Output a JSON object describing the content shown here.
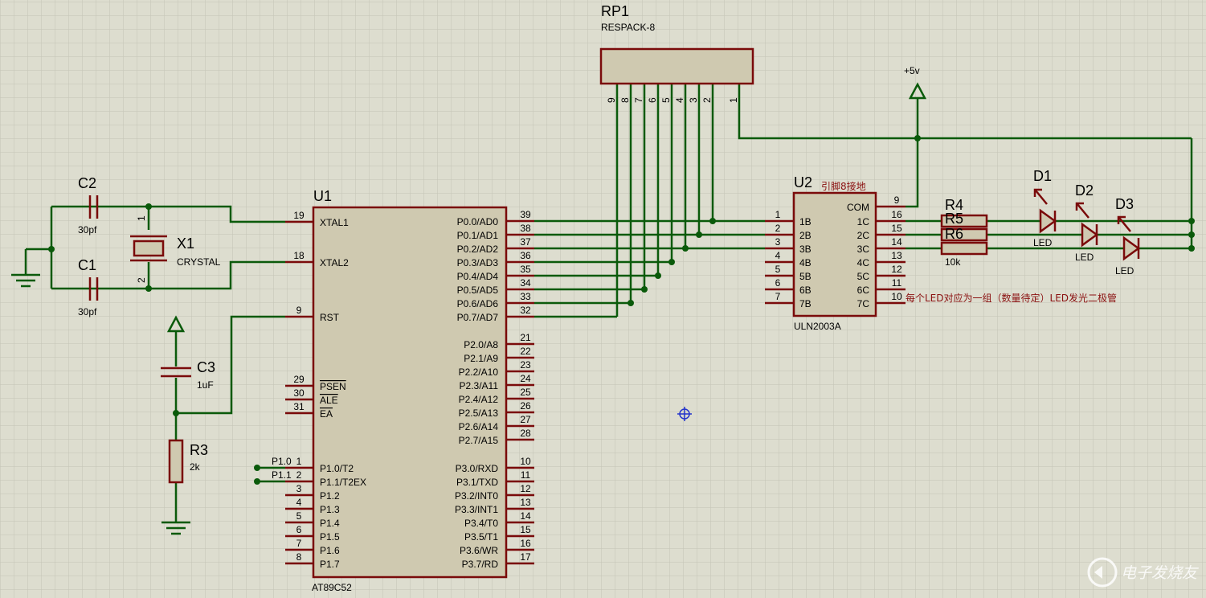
{
  "u1": {
    "ref": "U1",
    "part": "AT89C52",
    "left_pins": [
      {
        "num": "19",
        "name": "XTAL1"
      },
      {
        "num": "18",
        "name": "XTAL2"
      },
      {
        "num": "9",
        "name": "RST"
      },
      {
        "num": "29",
        "name": "PSEN"
      },
      {
        "num": "30",
        "name": "ALE"
      },
      {
        "num": "31",
        "name": "EA"
      },
      {
        "num": "1",
        "name": "P1.0/T2"
      },
      {
        "num": "2",
        "name": "P1.1/T2EX"
      },
      {
        "num": "3",
        "name": "P1.2"
      },
      {
        "num": "4",
        "name": "P1.3"
      },
      {
        "num": "5",
        "name": "P1.4"
      },
      {
        "num": "6",
        "name": "P1.5"
      },
      {
        "num": "7",
        "name": "P1.6"
      },
      {
        "num": "8",
        "name": "P1.7"
      }
    ],
    "right_pins": [
      {
        "num": "39",
        "name": "P0.0/AD0"
      },
      {
        "num": "38",
        "name": "P0.1/AD1"
      },
      {
        "num": "37",
        "name": "P0.2/AD2"
      },
      {
        "num": "36",
        "name": "P0.3/AD3"
      },
      {
        "num": "35",
        "name": "P0.4/AD4"
      },
      {
        "num": "34",
        "name": "P0.5/AD5"
      },
      {
        "num": "33",
        "name": "P0.6/AD6"
      },
      {
        "num": "32",
        "name": "P0.7/AD7"
      },
      {
        "num": "21",
        "name": "P2.0/A8"
      },
      {
        "num": "22",
        "name": "P2.1/A9"
      },
      {
        "num": "23",
        "name": "P2.2/A10"
      },
      {
        "num": "24",
        "name": "P2.3/A11"
      },
      {
        "num": "25",
        "name": "P2.4/A12"
      },
      {
        "num": "26",
        "name": "P2.5/A13"
      },
      {
        "num": "27",
        "name": "P2.6/A14"
      },
      {
        "num": "28",
        "name": "P2.7/A15"
      },
      {
        "num": "10",
        "name": "P3.0/RXD"
      },
      {
        "num": "11",
        "name": "P3.1/TXD"
      },
      {
        "num": "12",
        "name": "P3.2/INT0"
      },
      {
        "num": "13",
        "name": "P3.3/INT1"
      },
      {
        "num": "14",
        "name": "P3.4/T0"
      },
      {
        "num": "15",
        "name": "P3.5/T1"
      },
      {
        "num": "16",
        "name": "P3.6/WR"
      },
      {
        "num": "17",
        "name": "P3.7/RD"
      }
    ],
    "net_p10": "P1.0",
    "net_p11": "P1.1"
  },
  "u2": {
    "ref": "U2",
    "part": "ULN2003A",
    "note": "引脚8接地",
    "left_pins": [
      {
        "num": "1",
        "name": "1B"
      },
      {
        "num": "2",
        "name": "2B"
      },
      {
        "num": "3",
        "name": "3B"
      },
      {
        "num": "4",
        "name": "4B"
      },
      {
        "num": "5",
        "name": "5B"
      },
      {
        "num": "6",
        "name": "6B"
      },
      {
        "num": "7",
        "name": "7B"
      }
    ],
    "right_pins": [
      {
        "num": "9",
        "name": "COM"
      },
      {
        "num": "16",
        "name": "1C"
      },
      {
        "num": "15",
        "name": "2C"
      },
      {
        "num": "14",
        "name": "3C"
      },
      {
        "num": "13",
        "name": "4C"
      },
      {
        "num": "12",
        "name": "5C"
      },
      {
        "num": "11",
        "name": "6C"
      },
      {
        "num": "10",
        "name": "7C"
      }
    ]
  },
  "rp1": {
    "ref": "RP1",
    "part": "RESPACK-8",
    "pins": [
      "9",
      "8",
      "7",
      "6",
      "5",
      "4",
      "3",
      "2",
      "1"
    ]
  },
  "power_label": "+5v",
  "c1": {
    "ref": "C1",
    "value": "30pf"
  },
  "c2": {
    "ref": "C2",
    "value": "30pf"
  },
  "c3": {
    "ref": "C3",
    "value": "1uF"
  },
  "x1": {
    "ref": "X1",
    "value": "CRYSTAL",
    "pin1": "1",
    "pin2": "2"
  },
  "r3": {
    "ref": "R3",
    "value": "2k"
  },
  "r4": {
    "ref": "R4"
  },
  "r5": {
    "ref": "R5"
  },
  "r6": {
    "ref": "R6",
    "value": "10k"
  },
  "d1": {
    "ref": "D1",
    "value": "LED"
  },
  "d2": {
    "ref": "D2",
    "value": "LED"
  },
  "d3": {
    "ref": "D3",
    "value": "LED"
  },
  "annotation": "每个LED对应为一组（数量待定）LED发光二极管",
  "watermark": "电子发烧友"
}
